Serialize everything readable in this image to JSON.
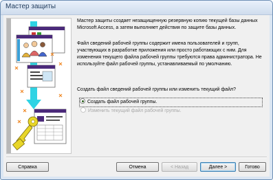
{
  "window": {
    "title": "Мастер защиты"
  },
  "intro_text": "Мастер защиты создает незащищенную резервную копию текущей базы данных Microsoft Access, а затем выполняет действия по защите базы данных.",
  "workgroup_text": "Файл сведений рабочей группы содержит имена пользователей и групп, участвующих в разработке приложения или просто работающих с ним. Для изменения текущего файла рабочей группы требуются права администратора. Не используйте файл рабочей группы, устанавливаемый по умолчанию.",
  "question": "Создать файл сведений рабочей группы или изменить текущий файл?",
  "options": [
    {
      "label": "Создать файл рабочей группы.",
      "selected": true,
      "enabled": true
    },
    {
      "label": "Изменить текущий файл рабочей группы.",
      "selected": false,
      "enabled": false
    }
  ],
  "buttons": {
    "help": "Справка",
    "cancel": "Отмена",
    "back": "< Назад",
    "next": "Далее >",
    "finish": "Готово"
  },
  "illustration": {
    "description_icon": "security-wizard-illustration-icon",
    "elements": [
      "user-group-icon",
      "database-forms-icon",
      "key-icon",
      "arrow-icon"
    ]
  },
  "colors": {
    "title_bar": "#cfdced",
    "dialog_bg": "#f0f0f0",
    "accent_cyan": "#2fd3e4",
    "key_yellow": "#e8d628",
    "form_purple": "#4b2a7a"
  }
}
